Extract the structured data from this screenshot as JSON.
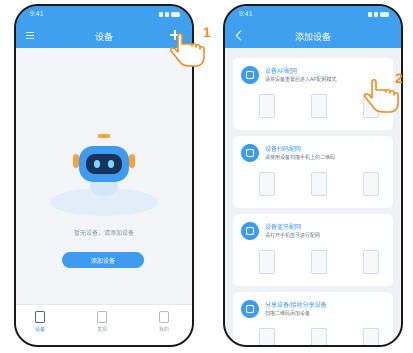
{
  "left_phone": {
    "status_time": "9:41",
    "appbar_title": "设备",
    "hint": "暂无设备，请添加设备",
    "add_button": "添加设备",
    "tabs": [
      {
        "label": "设备"
      },
      {
        "label": "发现"
      },
      {
        "label": "我的"
      }
    ]
  },
  "right_phone": {
    "status_time": "9:41",
    "appbar_title": "添加设备",
    "cards": [
      {
        "title": "设备AP配网",
        "desc": "请将设备重置后进入AP配网模式"
      },
      {
        "title": "设备扫码配网",
        "desc": "请使用设备扫描手机上的二维码"
      },
      {
        "title": "设备蓝牙配网",
        "desc": "请打开手机蓝牙进行配网"
      },
      {
        "title": "分享设备/接收分享设备",
        "desc": "扫描二维码添加设备"
      }
    ]
  },
  "steps": {
    "one": "1",
    "two": "2"
  },
  "colors": {
    "primary": "#3ea0ee",
    "accent": "#f28a1e",
    "robot_face": "#16335e"
  }
}
